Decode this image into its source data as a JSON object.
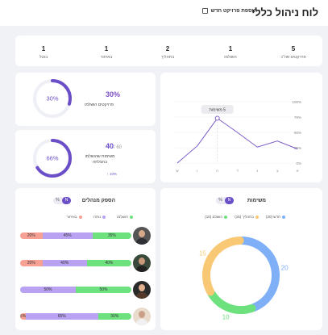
{
  "header": {
    "title": "לוח ניהול כללי",
    "add_project": "הוספת פרויקט חדש"
  },
  "stats": [
    {
      "value": "5",
      "label": "פרויקטים סה\"כ"
    },
    {
      "value": "1",
      "label": "הושלמו"
    },
    {
      "value": "2",
      "label": "בתהליך"
    },
    {
      "value": "1",
      "label": "באיחור"
    },
    {
      "value": "1",
      "label": "בוטל"
    }
  ],
  "progress_projects": {
    "percent": 0.3,
    "center": "30%",
    "big": "30%",
    "label": "פרויקטים הושלמו"
  },
  "progress_tasks": {
    "percent": 0.66,
    "center": "66%",
    "done": "40",
    "total": "/ 60",
    "label": "משימות שהושלמו בהצלחה",
    "delta": "10% ↑"
  },
  "line_chart": {
    "tooltip": "5 משימות",
    "x_ticks": [
      "א",
      "ב",
      "ג",
      "ד",
      "ה",
      "ו",
      "ש"
    ],
    "y_ticks": [
      "0%",
      "25%",
      "50%",
      "75%",
      "100%"
    ]
  },
  "chart_data": {
    "type": "line",
    "x": [
      "א",
      "ב",
      "ג",
      "ד",
      "ה",
      "ו",
      "ש"
    ],
    "values": [
      0,
      28,
      73,
      50,
      26,
      36,
      23
    ],
    "ylim": [
      0,
      100
    ],
    "grid": true
  },
  "managers": {
    "title": "הספק מנהלים",
    "toggle_on": "N",
    "toggle_off": "%",
    "legend": [
      "הושלמו",
      "נותרו",
      "באיחור"
    ],
    "colors": {
      "done": "#6ee17f",
      "left": "#b9a2f2",
      "late": "#f7a195"
    },
    "rows": [
      {
        "late": "20%",
        "left": "45%",
        "done": "35%",
        "late_v": 20,
        "left_v": 45,
        "done_v": 35
      },
      {
        "late": "20%",
        "left": "40%",
        "done": "40%",
        "late_v": 20,
        "left_v": 40,
        "done_v": 40
      },
      {
        "late": "",
        "left": "50%",
        "done": "50%",
        "late_v": 0,
        "left_v": 50,
        "done_v": 50
      },
      {
        "late": "5%",
        "left": "65%",
        "done": "30%",
        "late_v": 5,
        "left_v": 65,
        "done_v": 30
      }
    ]
  },
  "tasks": {
    "title": "משימות",
    "toggle_on": "N",
    "toggle_off": "%",
    "legend": [
      "חדש (20)",
      "בתהליך (15)",
      "הושלם (10)"
    ],
    "donut": [
      {
        "name": "חדש",
        "value": 20,
        "label": "20",
        "color": "#7fb0f7"
      },
      {
        "name": "הושלם",
        "value": 10,
        "label": "10",
        "color": "#6ee17f"
      },
      {
        "name": "בתהליך",
        "value": 15,
        "label": "15",
        "color": "#f8c874"
      }
    ]
  }
}
